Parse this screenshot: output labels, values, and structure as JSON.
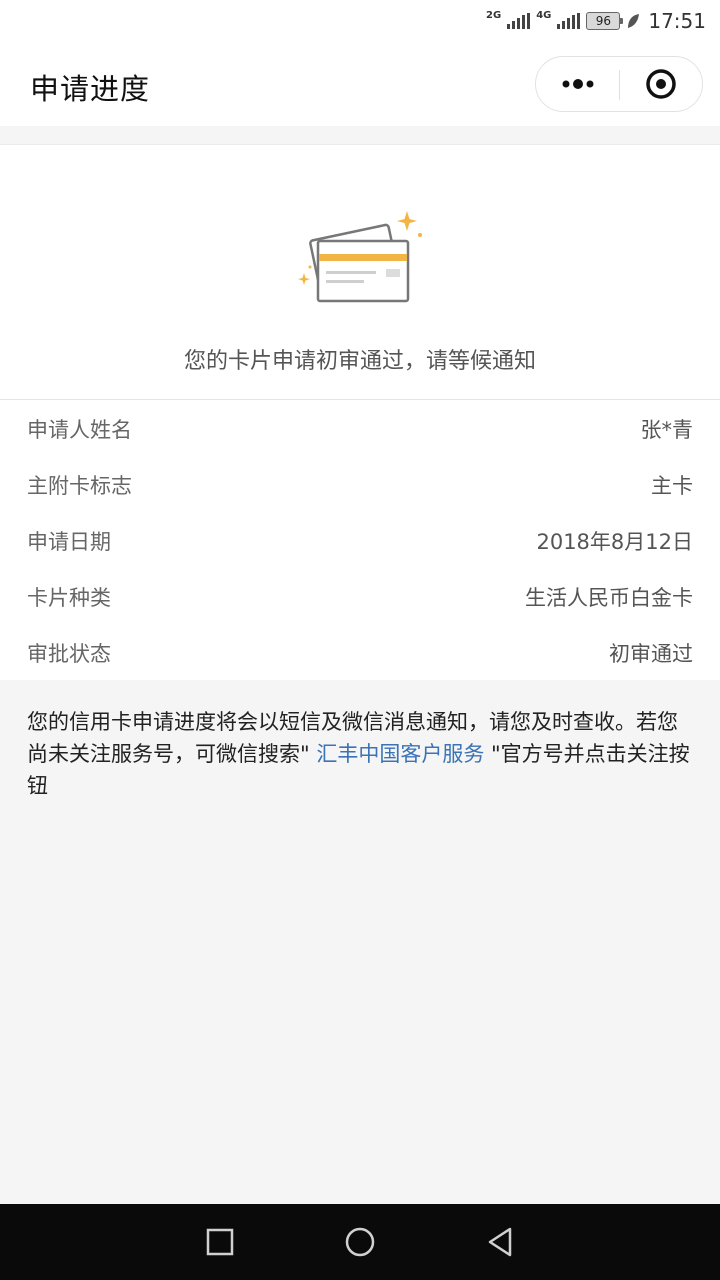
{
  "status_bar": {
    "network_1": "2G",
    "network_2": "4G",
    "battery": "96",
    "time": "17:51"
  },
  "header": {
    "title": "申请进度"
  },
  "hero": {
    "message": "您的卡片申请初审通过，请等候通知"
  },
  "details": [
    {
      "label": "申请人姓名",
      "value": "张*青"
    },
    {
      "label": "主附卡标志",
      "value": "主卡"
    },
    {
      "label": "申请日期",
      "value": "2018年8月12日"
    },
    {
      "label": "卡片种类",
      "value": "生活人民币白金卡"
    },
    {
      "label": "审批状态",
      "value": "初审通过"
    }
  ],
  "notice": {
    "text_before": "您的信用卡申请进度将会以短信及微信消息通知，请您及时查收。若您尚未关注服务号，可微信搜索\" ",
    "link": "汇丰中国客户服务",
    "text_after": " \"官方号并点击关注按钮"
  },
  "colors": {
    "link": "#3a73b6",
    "accent_gold": "#f2b545"
  }
}
